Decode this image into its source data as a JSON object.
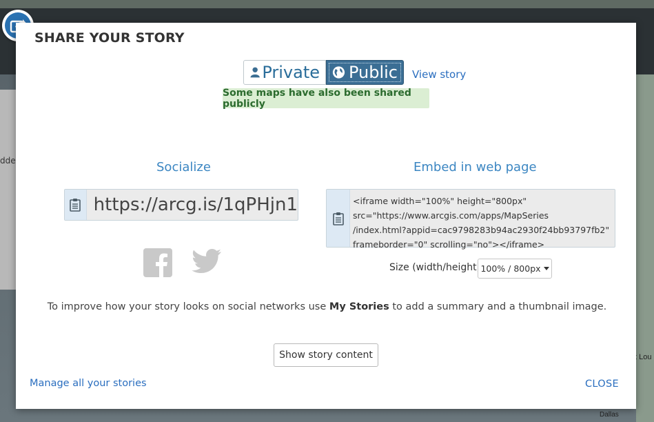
{
  "background": {
    "left_partial_text": "dde",
    "right_partial_text": "t Lou",
    "right_bottom_text": "Dallas"
  },
  "dialog": {
    "title": "SHARE YOUR STORY",
    "icon": "share-icon",
    "privacy": {
      "private_label": "Private",
      "public_label": "Public",
      "selected": "Public",
      "private_icon": "person-icon",
      "public_icon": "globe-icon"
    },
    "view_story_link": "View story",
    "notice": "Some maps have also been shared publicly",
    "socialize": {
      "title": "Socialize",
      "short_url": "https://arcg.is/1qPHjn1",
      "copy_icon": "clipboard-icon",
      "networks": [
        "facebook-icon",
        "twitter-icon"
      ]
    },
    "embed": {
      "title": "Embed in web page",
      "code": "<iframe width=\"100%\" height=\"800px\"\nsrc=\"https://www.arcgis.com/apps/MapSeries\n/index.html?appid=cac9798283b94ac2930f24bb93797fb2\"\nframeborder=\"0\" scrolling=\"no\"></iframe>",
      "copy_icon": "clipboard-icon",
      "size_label": "Size (width/height):",
      "size_value": "100% / 800px"
    },
    "tip": {
      "before": "To improve how your story looks on social networks use ",
      "bold": "My Stories",
      "after": " to add a summary and a thumbnail image."
    },
    "show_content_button": "Show story content",
    "manage_link": "Manage all your stories",
    "close_link": "CLOSE"
  },
  "colors": {
    "accent": "#3b86c2",
    "link": "#2a6ebf",
    "toggle_selected": "#3b6e94",
    "notice_bg": "#dbeed3",
    "notice_text": "#2b6b2e"
  }
}
